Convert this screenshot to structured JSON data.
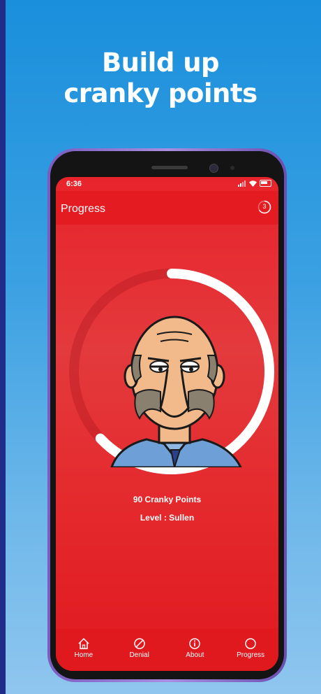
{
  "headline": {
    "line1": "Build up",
    "line2": "cranky points"
  },
  "status_bar": {
    "time": "6:36"
  },
  "app_bar": {
    "title": "Progress",
    "badge_count": "3"
  },
  "progress": {
    "points_text": "90 Cranky Points",
    "level_text": "Level : Sullen",
    "fraction": 0.63
  },
  "nav": {
    "items": [
      {
        "label": "Home",
        "icon": "home-icon"
      },
      {
        "label": "Denial",
        "icon": "block-icon"
      },
      {
        "label": "About",
        "icon": "info-icon"
      },
      {
        "label": "Progress",
        "icon": "circle-icon"
      }
    ]
  },
  "colors": {
    "accent_red": "#e51b22",
    "background_blue": "#1a8fdc",
    "phone_frame": "#8a6cd0"
  }
}
